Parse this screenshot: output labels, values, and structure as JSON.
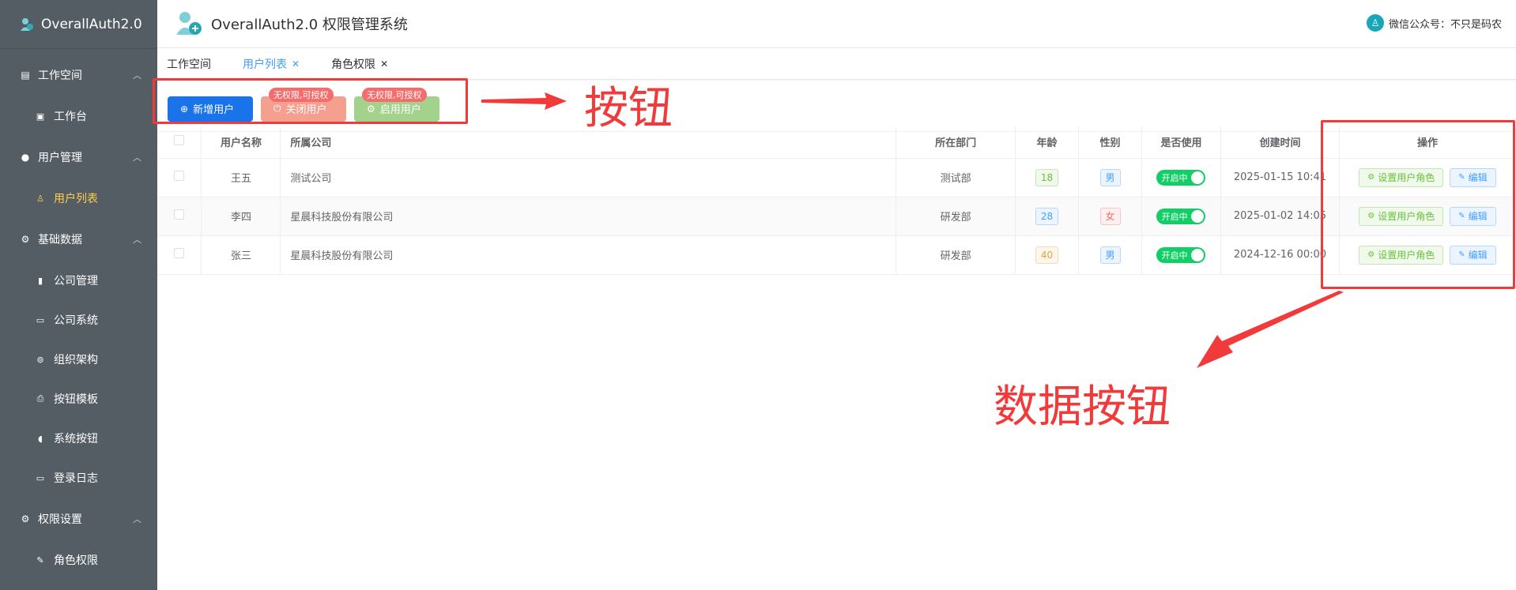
{
  "sidebar": {
    "brand": "OverallAuth2.0",
    "groups": [
      {
        "label": "工作空间",
        "items": [
          {
            "label": "工作台",
            "icon": "dashboard-icon"
          }
        ]
      },
      {
        "label": "用户管理",
        "items": [
          {
            "label": "用户列表",
            "icon": "user-icon",
            "active": true
          }
        ]
      },
      {
        "label": "基础数据",
        "items": [
          {
            "label": "公司管理",
            "icon": "bar-chart-icon"
          },
          {
            "label": "公司系统",
            "icon": "monitor-icon"
          },
          {
            "label": "组织架构",
            "icon": "org-icon"
          },
          {
            "label": "按钮模板",
            "icon": "printer-icon"
          },
          {
            "label": "系统按钮",
            "icon": "mouse-icon"
          },
          {
            "label": "登录日志",
            "icon": "monitor-icon"
          }
        ]
      },
      {
        "label": "权限设置",
        "items": [
          {
            "label": "角色权限",
            "icon": "edit-icon"
          }
        ]
      }
    ]
  },
  "header": {
    "title": "OverallAuth2.0 权限管理系统",
    "user_label": "微信公众号：不只是码农"
  },
  "tabs": [
    {
      "label": "工作空间",
      "closable": false,
      "active": false
    },
    {
      "label": "用户列表",
      "closable": true,
      "active": true
    },
    {
      "label": "角色权限",
      "closable": true,
      "active": false
    }
  ],
  "toolbar": {
    "add_user": "新增用户",
    "close_user": "关闭用户",
    "enable_user": "启用用户",
    "no_perm_badge": "无权限,可授权"
  },
  "annotations": {
    "buttons_label": "按钮",
    "data_buttons_label": "数据按钮"
  },
  "table": {
    "headers": [
      "用户名称",
      "所属公司",
      "所在部门",
      "年龄",
      "性别",
      "是否使用",
      "创建时间",
      "操作"
    ],
    "rows": [
      {
        "name": "王五",
        "company": "测试公司",
        "dept": "测试部",
        "age": "18",
        "gender": "男",
        "enabled": "开启中",
        "created": "2025-01-15 10:41"
      },
      {
        "name": "李四",
        "company": "星晨科技股份有限公司",
        "dept": "研发部",
        "age": "28",
        "gender": "女",
        "enabled": "开启中",
        "created": "2025-01-02 14:05"
      },
      {
        "name": "张三",
        "company": "星晨科技股份有限公司",
        "dept": "研发部",
        "age": "40",
        "gender": "男",
        "enabled": "开启中",
        "created": "2024-12-16 00:00"
      }
    ],
    "op_set_role": "设置用户角色",
    "op_edit": "编辑"
  }
}
